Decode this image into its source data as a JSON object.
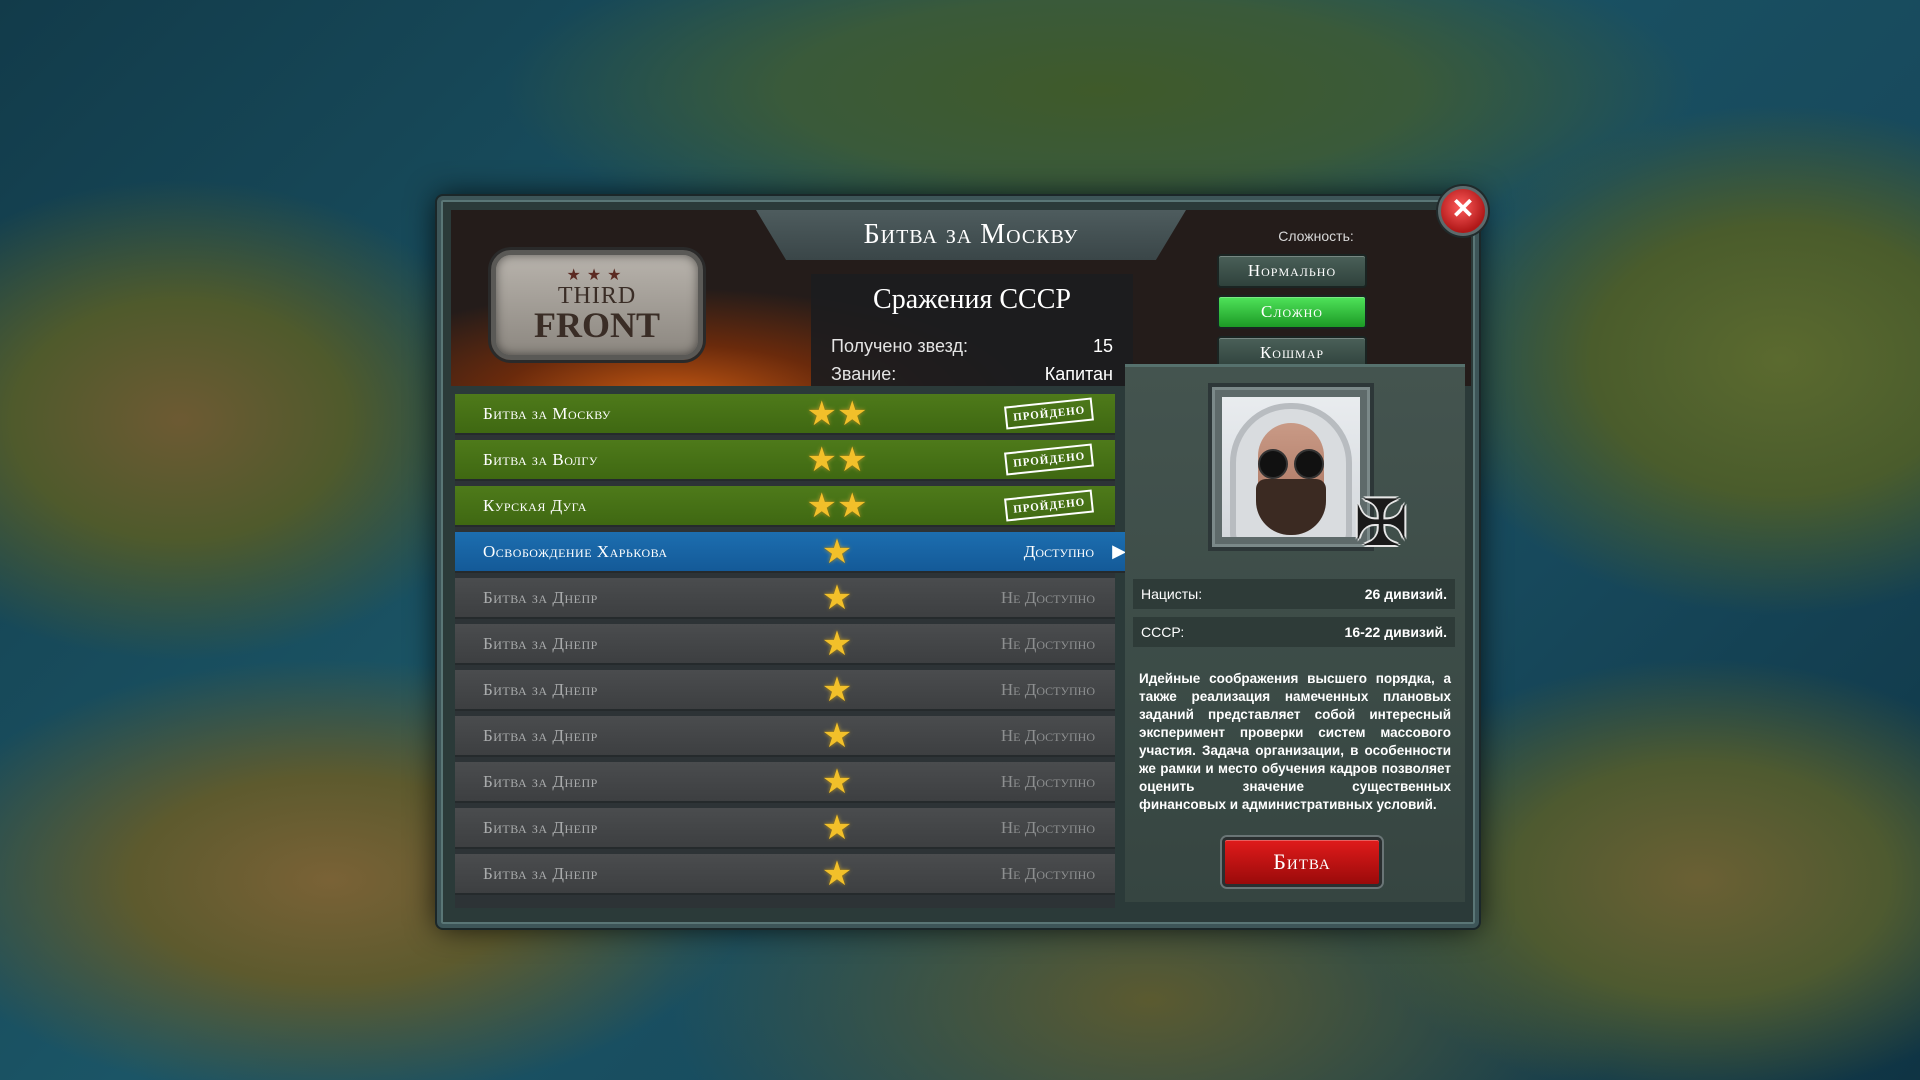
{
  "window": {
    "title": "Битва за Москву",
    "close_icon": "close-icon"
  },
  "logo": {
    "stars": "★★★",
    "line1": "THIRD",
    "line2": "FRONT"
  },
  "stats": {
    "title": "Сражения СССР",
    "stars_label": "Получено звезд:",
    "stars_value": "15",
    "rank_label": "Звание:",
    "rank_value": "Капитан"
  },
  "difficulty": {
    "label": "Сложность:",
    "options": [
      "Нормально",
      "Сложно",
      "Кошмар"
    ],
    "selected": "Сложно"
  },
  "missions": [
    {
      "name": "Битва за Москву",
      "stars": "★★",
      "status": "пройдено",
      "state": "done"
    },
    {
      "name": "Битва за Волгу",
      "stars": "★★",
      "status": "пройдено",
      "state": "done"
    },
    {
      "name": "Курская Дуга",
      "stars": "★★",
      "status": "пройдено",
      "state": "done"
    },
    {
      "name": "Освобождение Харькова",
      "stars": "★",
      "status": "Доступно",
      "state": "available",
      "arrow": "▶"
    },
    {
      "name": "Битва за Днепр",
      "stars": "★",
      "status": "Не Доступно",
      "state": "locked"
    },
    {
      "name": "Битва за Днепр",
      "stars": "★",
      "status": "Не Доступно",
      "state": "locked"
    },
    {
      "name": "Битва за Днепр",
      "stars": "★",
      "status": "Не Доступно",
      "state": "locked"
    },
    {
      "name": "Битва за Днепр",
      "stars": "★",
      "status": "Не Доступно",
      "state": "locked"
    },
    {
      "name": "Битва за Днепр",
      "stars": "★",
      "status": "Не Доступно",
      "state": "locked"
    },
    {
      "name": "Битва за Днепр",
      "stars": "★",
      "status": "Не Доступно",
      "state": "locked"
    },
    {
      "name": "Битва за Днепр",
      "stars": "★",
      "status": "Не Доступно",
      "state": "locked"
    }
  ],
  "info": {
    "cross_glyph": "✠",
    "nazis_label": "Нацисты:",
    "nazis_value": "26 дивизий.",
    "ussr_label": "СССР:",
    "ussr_value": "16-22 дивизий.",
    "description": "Идейные соображения высшего порядка, а также реализация намеченных плановых заданий представляет собой интересный эксперимент проверки систем массового участия. Задача организации, в особенности же рамки и место обучения кадров позволяет оценить значение существенных финансовых и административных условий.",
    "battle_button": "Битва"
  },
  "colors": {
    "done_row": "#4e7a1a",
    "available_row": "#1c6eb0",
    "locked_row": "#4a4c4e",
    "active_difficulty": "#2fc23a",
    "battle_button": "#c41212"
  }
}
